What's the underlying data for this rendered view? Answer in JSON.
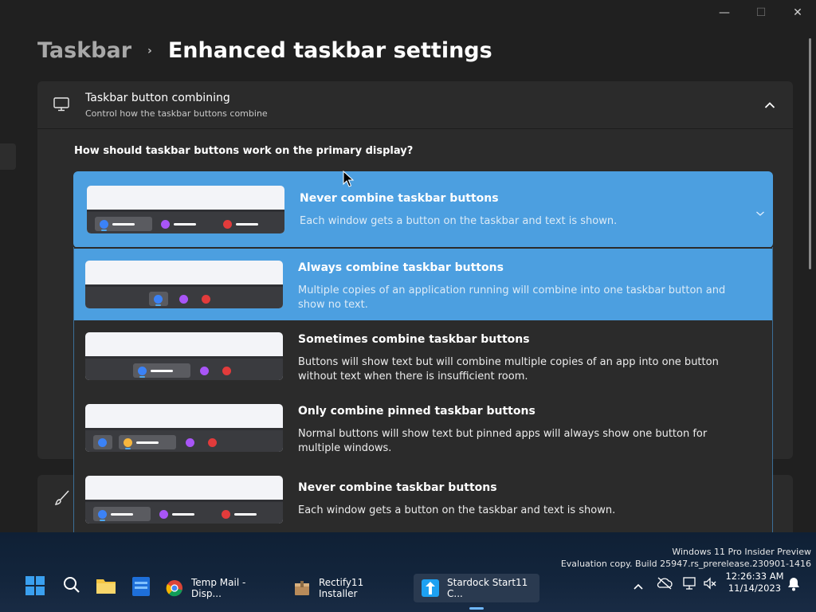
{
  "window": {
    "minimize_glyph": "—",
    "maximize_glyph": "☐",
    "close_glyph": "✕"
  },
  "breadcrumb": {
    "parent": "Taskbar",
    "separator": "›",
    "current": "Enhanced taskbar settings"
  },
  "card": {
    "icon": "monitor-icon",
    "title": "Taskbar button combining",
    "subtitle": "Control how the taskbar buttons combine",
    "question": "How should taskbar buttons work on the primary display?"
  },
  "combo": {
    "selected_title": "Never combine taskbar buttons",
    "selected_desc": "Each window gets a button on the taskbar and text is shown."
  },
  "options": [
    {
      "title": "Always combine taskbar buttons",
      "desc": "Multiple copies of an application running will combine into one taskbar button and show no text."
    },
    {
      "title": "Sometimes combine taskbar buttons",
      "desc": "Buttons will show text but will combine multiple copies of an app into one button without text when there is insufficient room."
    },
    {
      "title": "Only combine pinned taskbar buttons",
      "desc": "Normal buttons will show text but pinned apps will always show one button for multiple windows."
    },
    {
      "title": "Never combine taskbar buttons",
      "desc": "Each window gets a button on the taskbar and text is shown."
    }
  ],
  "watermark": {
    "line1": "Windows 11 Pro Insider Preview",
    "line2": "Evaluation copy. Build 25947.rs_prerelease.230901-1416"
  },
  "taskbar": {
    "apps": [
      {
        "label": "Temp Mail - Disp...",
        "icon": "chrome-icon"
      },
      {
        "label": "Rectify11 Installer",
        "icon": "installer-icon"
      },
      {
        "label": "Stardock Start11 C...",
        "icon": "start11-icon"
      }
    ],
    "clock_time": "12:26:33 AM",
    "clock_date": "11/14/2023",
    "tray_chevron": "^"
  },
  "colors": {
    "accent": "#4c9fe0",
    "background": "#202020",
    "card": "#2b2b2b"
  }
}
